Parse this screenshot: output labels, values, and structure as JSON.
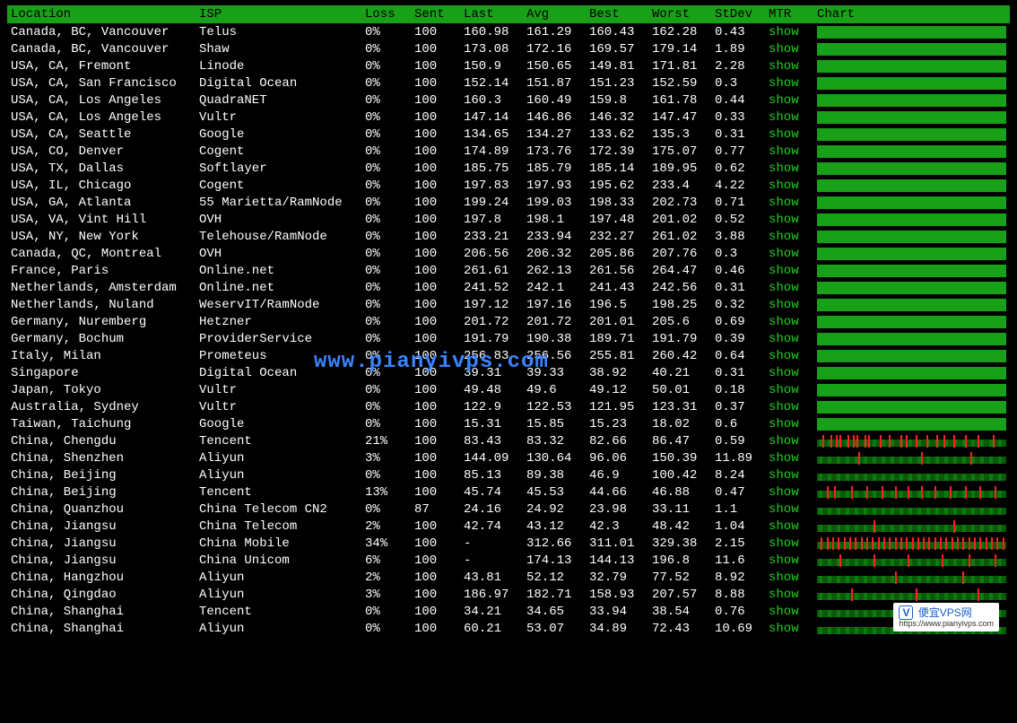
{
  "headers": {
    "location": "Location",
    "isp": "ISP",
    "loss": "Loss",
    "sent": "Sent",
    "last": "Last",
    "avg": "Avg",
    "best": "Best",
    "worst": "Worst",
    "stdev": "StDev",
    "mtr": "MTR",
    "chart": "Chart"
  },
  "mtr_label": "show",
  "watermark": {
    "center": "www.pianyivps.com",
    "logo_title": "便宜VPS网",
    "logo_url": "https://www.pianyivps.com"
  },
  "rows": [
    {
      "location": "Canada, BC, Vancouver",
      "isp": "Telus",
      "loss": "0%",
      "sent": "100",
      "last": "160.98",
      "avg": "161.29",
      "best": "160.43",
      "worst": "162.28",
      "stdev": "0.43",
      "lossy": false,
      "marks": []
    },
    {
      "location": "Canada, BC, Vancouver",
      "isp": "Shaw",
      "loss": "0%",
      "sent": "100",
      "last": "173.08",
      "avg": "172.16",
      "best": "169.57",
      "worst": "179.14",
      "stdev": "1.89",
      "lossy": false,
      "marks": []
    },
    {
      "location": "USA, CA, Fremont",
      "isp": "Linode",
      "loss": "0%",
      "sent": "100",
      "last": "150.9",
      "avg": "150.65",
      "best": "149.81",
      "worst": "171.81",
      "stdev": "2.28",
      "lossy": false,
      "marks": []
    },
    {
      "location": "USA, CA, San Francisco",
      "isp": "Digital Ocean",
      "loss": "0%",
      "sent": "100",
      "last": "152.14",
      "avg": "151.87",
      "best": "151.23",
      "worst": "152.59",
      "stdev": "0.3",
      "lossy": false,
      "marks": []
    },
    {
      "location": "USA, CA, Los Angeles",
      "isp": "QuadraNET",
      "loss": "0%",
      "sent": "100",
      "last": "160.3",
      "avg": "160.49",
      "best": "159.8",
      "worst": "161.78",
      "stdev": "0.44",
      "lossy": false,
      "marks": []
    },
    {
      "location": "USA, CA, Los Angeles",
      "isp": "Vultr",
      "loss": "0%",
      "sent": "100",
      "last": "147.14",
      "avg": "146.86",
      "best": "146.32",
      "worst": "147.47",
      "stdev": "0.33",
      "lossy": false,
      "marks": []
    },
    {
      "location": "USA, CA, Seattle",
      "isp": "Google",
      "loss": "0%",
      "sent": "100",
      "last": "134.65",
      "avg": "134.27",
      "best": "133.62",
      "worst": "135.3",
      "stdev": "0.31",
      "lossy": false,
      "marks": []
    },
    {
      "location": "USA, CO, Denver",
      "isp": "Cogent",
      "loss": "0%",
      "sent": "100",
      "last": "174.89",
      "avg": "173.76",
      "best": "172.39",
      "worst": "175.07",
      "stdev": "0.77",
      "lossy": false,
      "marks": []
    },
    {
      "location": "USA, TX, Dallas",
      "isp": "Softlayer",
      "loss": "0%",
      "sent": "100",
      "last": "185.75",
      "avg": "185.79",
      "best": "185.14",
      "worst": "189.95",
      "stdev": "0.62",
      "lossy": false,
      "marks": []
    },
    {
      "location": "USA, IL, Chicago",
      "isp": "Cogent",
      "loss": "0%",
      "sent": "100",
      "last": "197.83",
      "avg": "197.93",
      "best": "195.62",
      "worst": "233.4",
      "stdev": "4.22",
      "lossy": false,
      "marks": []
    },
    {
      "location": "USA, GA, Atlanta",
      "isp": "55 Marietta/RamNode",
      "loss": "0%",
      "sent": "100",
      "last": "199.24",
      "avg": "199.03",
      "best": "198.33",
      "worst": "202.73",
      "stdev": "0.71",
      "lossy": false,
      "marks": []
    },
    {
      "location": "USA, VA, Vint Hill",
      "isp": "OVH",
      "loss": "0%",
      "sent": "100",
      "last": "197.8",
      "avg": "198.1",
      "best": "197.48",
      "worst": "201.02",
      "stdev": "0.52",
      "lossy": false,
      "marks": []
    },
    {
      "location": "USA, NY, New York",
      "isp": "Telehouse/RamNode",
      "loss": "0%",
      "sent": "100",
      "last": "233.21",
      "avg": "233.94",
      "best": "232.27",
      "worst": "261.02",
      "stdev": "3.88",
      "lossy": false,
      "marks": []
    },
    {
      "location": "Canada, QC, Montreal",
      "isp": "OVH",
      "loss": "0%",
      "sent": "100",
      "last": "206.56",
      "avg": "206.32",
      "best": "205.86",
      "worst": "207.76",
      "stdev": "0.3",
      "lossy": false,
      "marks": []
    },
    {
      "location": "France, Paris",
      "isp": "Online.net",
      "loss": "0%",
      "sent": "100",
      "last": "261.61",
      "avg": "262.13",
      "best": "261.56",
      "worst": "264.47",
      "stdev": "0.46",
      "lossy": false,
      "marks": []
    },
    {
      "location": "Netherlands, Amsterdam",
      "isp": "Online.net",
      "loss": "0%",
      "sent": "100",
      "last": "241.52",
      "avg": "242.1",
      "best": "241.43",
      "worst": "242.56",
      "stdev": "0.31",
      "lossy": false,
      "marks": []
    },
    {
      "location": "Netherlands, Nuland",
      "isp": "WeservIT/RamNode",
      "loss": "0%",
      "sent": "100",
      "last": "197.12",
      "avg": "197.16",
      "best": "196.5",
      "worst": "198.25",
      "stdev": "0.32",
      "lossy": false,
      "marks": []
    },
    {
      "location": "Germany, Nuremberg",
      "isp": "Hetzner",
      "loss": "0%",
      "sent": "100",
      "last": "201.72",
      "avg": "201.72",
      "best": "201.01",
      "worst": "205.6",
      "stdev": "0.69",
      "lossy": false,
      "marks": []
    },
    {
      "location": "Germany, Bochum",
      "isp": "ProviderService",
      "loss": "0%",
      "sent": "100",
      "last": "191.79",
      "avg": "190.38",
      "best": "189.71",
      "worst": "191.79",
      "stdev": "0.39",
      "lossy": false,
      "marks": []
    },
    {
      "location": "Italy, Milan",
      "isp": "Prometeus",
      "loss": "0%",
      "sent": "100",
      "last": "256.83",
      "avg": "256.56",
      "best": "255.81",
      "worst": "260.42",
      "stdev": "0.64",
      "lossy": false,
      "marks": []
    },
    {
      "location": "Singapore",
      "isp": "Digital Ocean",
      "loss": "0%",
      "sent": "100",
      "last": "39.31",
      "avg": "39.33",
      "best": "38.92",
      "worst": "40.21",
      "stdev": "0.31",
      "lossy": false,
      "marks": []
    },
    {
      "location": "Japan, Tokyo",
      "isp": "Vultr",
      "loss": "0%",
      "sent": "100",
      "last": "49.48",
      "avg": "49.6",
      "best": "49.12",
      "worst": "50.01",
      "stdev": "0.18",
      "lossy": false,
      "marks": []
    },
    {
      "location": "Australia, Sydney",
      "isp": "Vultr",
      "loss": "0%",
      "sent": "100",
      "last": "122.9",
      "avg": "122.53",
      "best": "121.95",
      "worst": "123.31",
      "stdev": "0.37",
      "lossy": false,
      "marks": []
    },
    {
      "location": "Taiwan, Taichung",
      "isp": "Google",
      "loss": "0%",
      "sent": "100",
      "last": "15.31",
      "avg": "15.85",
      "best": "15.23",
      "worst": "18.02",
      "stdev": "0.6",
      "lossy": false,
      "marks": []
    },
    {
      "location": "China, Chengdu",
      "isp": "Tencent",
      "loss": "21%",
      "sent": "100",
      "last": "83.43",
      "avg": "83.32",
      "best": "82.66",
      "worst": "86.47",
      "stdev": "0.59",
      "lossy": true,
      "marks": [
        3,
        7,
        10,
        12,
        16,
        19,
        21,
        25,
        27,
        33,
        38,
        44,
        47,
        52,
        58,
        63,
        67,
        72,
        78,
        85,
        93
      ]
    },
    {
      "location": "China, Shenzhen",
      "isp": "Aliyun",
      "loss": "3%",
      "sent": "100",
      "last": "144.09",
      "avg": "130.64",
      "best": "96.06",
      "worst": "150.39",
      "stdev": "11.89",
      "lossy": true,
      "marks": [
        22,
        55,
        81
      ]
    },
    {
      "location": "China, Beijing",
      "isp": "Aliyun",
      "loss": "0%",
      "sent": "100",
      "last": "85.13",
      "avg": "89.38",
      "best": "46.9",
      "worst": "100.42",
      "stdev": "8.24",
      "lossy": true,
      "marks": []
    },
    {
      "location": "China, Beijing",
      "isp": "Tencent",
      "loss": "13%",
      "sent": "100",
      "last": "45.74",
      "avg": "45.53",
      "best": "44.66",
      "worst": "46.88",
      "stdev": "0.47",
      "lossy": true,
      "marks": [
        5,
        9,
        18,
        26,
        34,
        41,
        48,
        55,
        62,
        70,
        78,
        86,
        94
      ]
    },
    {
      "location": "China, Quanzhou",
      "isp": "China Telecom CN2",
      "loss": "0%",
      "sent": "87",
      "last": "24.16",
      "avg": "24.92",
      "best": "23.98",
      "worst": "33.11",
      "stdev": "1.1",
      "lossy": true,
      "marks": []
    },
    {
      "location": "China, Jiangsu",
      "isp": "China Telecom",
      "loss": "2%",
      "sent": "100",
      "last": "42.74",
      "avg": "43.12",
      "best": "42.3",
      "worst": "48.42",
      "stdev": "1.04",
      "lossy": true,
      "marks": [
        30,
        72
      ]
    },
    {
      "location": "China, Jiangsu",
      "isp": "China Mobile",
      "loss": "34%",
      "sent": "100",
      "last": "-",
      "avg": "312.66",
      "best": "311.01",
      "worst": "329.38",
      "stdev": "2.15",
      "lossy": true,
      "marks": [
        2,
        5,
        8,
        11,
        14,
        17,
        20,
        23,
        26,
        29,
        32,
        35,
        38,
        41,
        44,
        47,
        50,
        53,
        56,
        59,
        62,
        65,
        68,
        71,
        74,
        77,
        80,
        83,
        86,
        89,
        92,
        95,
        98
      ]
    },
    {
      "location": "China, Jiangsu",
      "isp": "China Unicom",
      "loss": "6%",
      "sent": "100",
      "last": "-",
      "avg": "174.13",
      "best": "144.13",
      "worst": "196.8",
      "stdev": "11.6",
      "lossy": true,
      "marks": [
        12,
        30,
        48,
        66,
        80,
        94
      ]
    },
    {
      "location": "China, Hangzhou",
      "isp": "Aliyun",
      "loss": "2%",
      "sent": "100",
      "last": "43.81",
      "avg": "52.12",
      "best": "32.79",
      "worst": "77.52",
      "stdev": "8.92",
      "lossy": true,
      "marks": [
        41,
        77
      ]
    },
    {
      "location": "China, Qingdao",
      "isp": "Aliyun",
      "loss": "3%",
      "sent": "100",
      "last": "186.97",
      "avg": "182.71",
      "best": "158.93",
      "worst": "207.57",
      "stdev": "8.88",
      "lossy": true,
      "marks": [
        18,
        52,
        85
      ]
    },
    {
      "location": "China, Shanghai",
      "isp": "Tencent",
      "loss": "0%",
      "sent": "100",
      "last": "34.21",
      "avg": "34.65",
      "best": "33.94",
      "worst": "38.54",
      "stdev": "0.76",
      "lossy": true,
      "marks": []
    },
    {
      "location": "China, Shanghai",
      "isp": "Aliyun",
      "loss": "0%",
      "sent": "100",
      "last": "60.21",
      "avg": "53.07",
      "best": "34.89",
      "worst": "72.43",
      "stdev": "10.69",
      "lossy": true,
      "marks": []
    }
  ]
}
